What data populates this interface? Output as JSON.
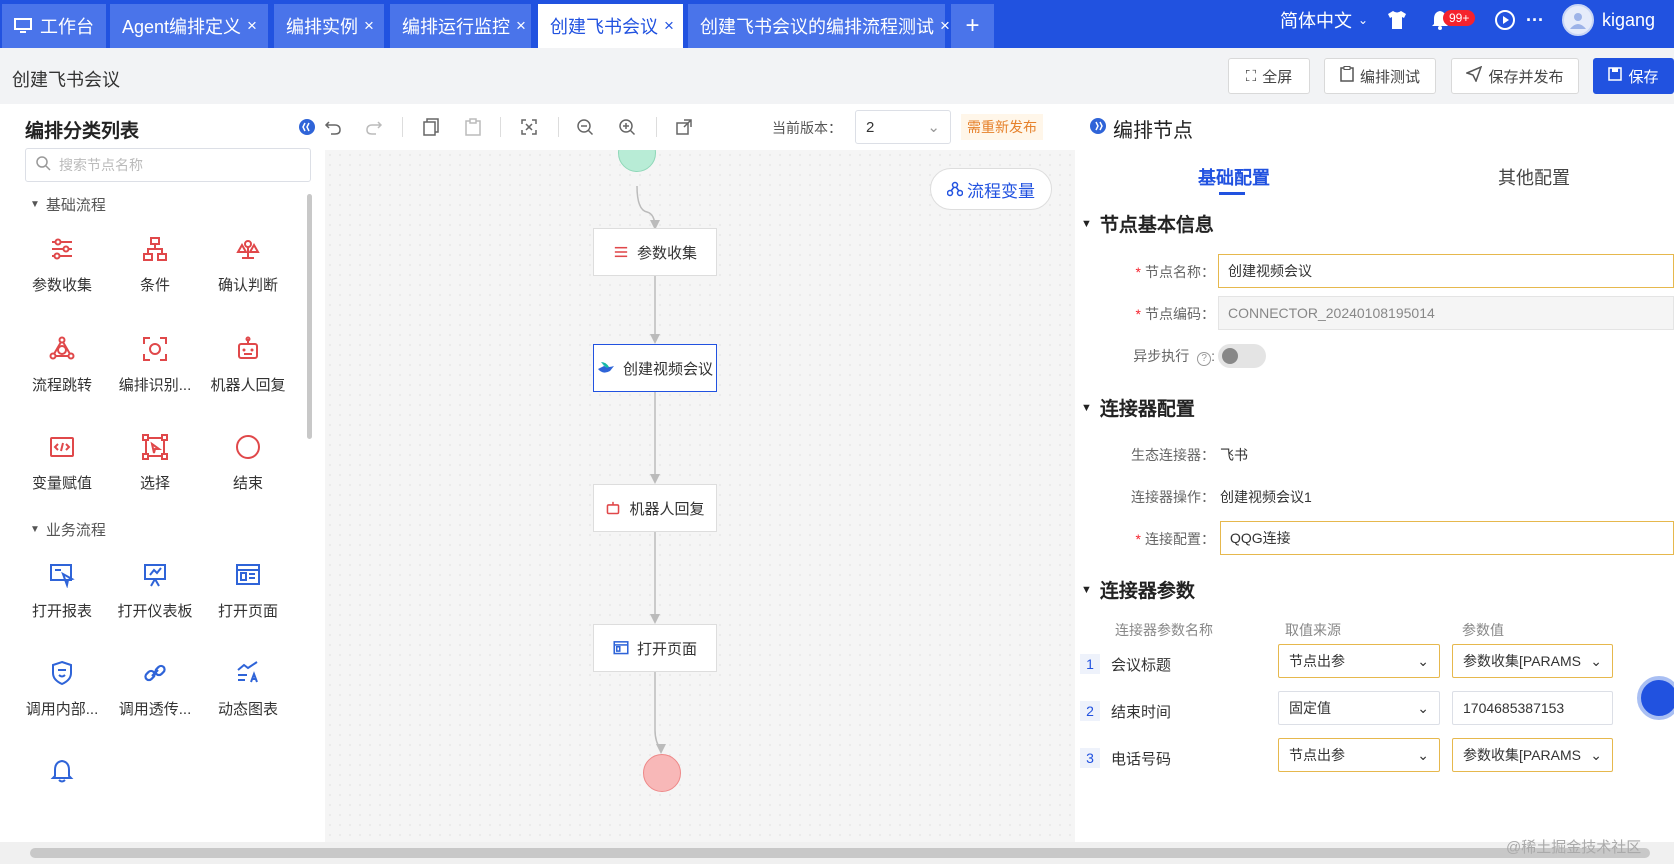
{
  "tabs": [
    {
      "label": "工作台",
      "icon": "desktop-icon",
      "closable": false
    },
    {
      "label": "Agent编排定义",
      "closable": true
    },
    {
      "label": "编排实例",
      "closable": true
    },
    {
      "label": "编排运行监控",
      "closable": true
    },
    {
      "label": "创建飞书会议",
      "closable": true,
      "active": true
    },
    {
      "label": "创建飞书会议的编排流程测试",
      "closable": true
    }
  ],
  "tab_close_glyph": "×",
  "tab_add_glyph": "+",
  "topbar": {
    "language": "简体中文",
    "notification_count": "99+",
    "more_glyph": "···",
    "username": "kigang"
  },
  "header": {
    "page_title": "创建飞书会议",
    "fullscreen_label": "全屏",
    "test_label": "编排测试",
    "save_publish_label": "保存并发布",
    "save_label": "保存"
  },
  "left_panel": {
    "title": "编排分类列表",
    "search_placeholder": "搜索节点名称",
    "groups": [
      {
        "title": "基础流程",
        "items": [
          "参数收集",
          "条件",
          "确认判断",
          "流程跳转",
          "编排识别...",
          "机器人回复",
          "变量赋值",
          "选择",
          "结束"
        ]
      },
      {
        "title": "业务流程",
        "items": [
          "打开报表",
          "打开仪表板",
          "打开页面",
          "调用内部...",
          "调用透传...",
          "动态图表"
        ]
      }
    ]
  },
  "toolbar": {
    "version_label": "当前版本：",
    "version_value": "2",
    "republish_label": "需重新发布"
  },
  "canvas": {
    "flow_var_label": "流程变量",
    "nodes": [
      "参数收集",
      "创建视频会议",
      "机器人回复",
      "打开页面"
    ]
  },
  "right_panel": {
    "title": "编排节点",
    "tabs": [
      "基础配置",
      "其他配置"
    ],
    "section_basic": "节点基本信息",
    "node_name_label": "节点名称：",
    "node_name_value": "创建视频会议",
    "node_code_label": "节点编码：",
    "node_code_value": "CONNECTOR_20240108195014",
    "async_label": "异步执行",
    "section_connector": "连接器配置",
    "eco_connector_label": "生态连接器：",
    "eco_connector_value": "飞书",
    "connector_op_label": "连接器操作：",
    "connector_op_value": "创建视频会议1",
    "connector_config_label": "连接配置：",
    "connector_config_value": "QQG连接",
    "section_params": "连接器参数",
    "param_headers": [
      "连接器参数名称",
      "取值来源",
      "参数值"
    ],
    "params": [
      {
        "index": "1",
        "name": "会议标题",
        "source": "节点出参",
        "value": "参数收集[PARAMS"
      },
      {
        "index": "2",
        "name": "结束时间",
        "source": "固定值",
        "value": "1704685387153"
      },
      {
        "index": "3",
        "name": "电话号码",
        "source": "节点出参",
        "value": "参数收集[PARAMS"
      }
    ]
  },
  "watermark": "@稀土掘金技术社区",
  "colors": {
    "brand": "#2152e0",
    "warning": "#e6812b",
    "danger": "#f5222d",
    "start": "#b8ecd6",
    "end": "#f8b8b8"
  }
}
